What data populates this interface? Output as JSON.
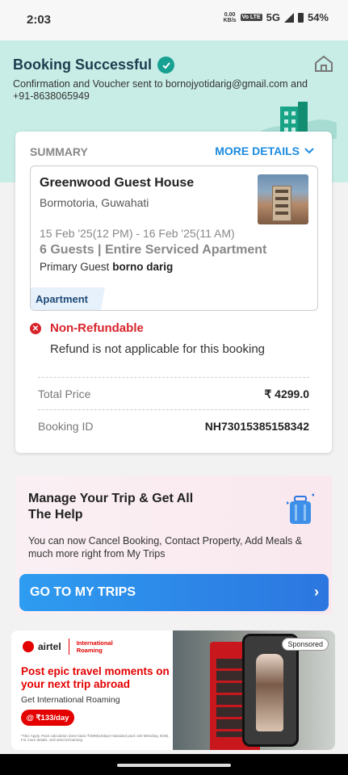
{
  "status_bar": {
    "time": "2:03",
    "speed_value": "0.00",
    "speed_unit": "KB/s",
    "lte": "Vo LTE",
    "network": "5G",
    "battery": "54%"
  },
  "header": {
    "title": "Booking Successful",
    "subtitle": "Confirmation and Voucher sent to bornojyotidarig@gmail.com and +91-8638065949"
  },
  "summary": {
    "label": "SUMMARY",
    "more_details": "MORE DETAILS",
    "hotel": {
      "name": "Greenwood Guest House",
      "location": "Bormotoria, Guwahati",
      "dates": "15 Feb '25(12 PM) - 16 Feb '25(11 AM)",
      "guests": "6 Guests | Entire Serviced Apartment",
      "primary_label": "Primary Guest",
      "primary_name": "borno darig",
      "tag": "Apartment"
    },
    "refund": {
      "title": "Non-Refundable",
      "text": "Refund is not applicable for this booking"
    },
    "total_price_label": "Total Price",
    "total_price_value": "₹ 4299.0",
    "booking_id_label": "Booking ID",
    "booking_id_value": "NH73015385158342"
  },
  "promo": {
    "title": "Manage Your Trip & Get All The Help",
    "text": "You can now Cancel Booking, Contact Property, Add Meals & much more right from My Trips",
    "button": "GO TO MY TRIPS"
  },
  "ad": {
    "brand": "airtel",
    "brand_sub_line1": "International",
    "brand_sub_line2": "Roaming",
    "headline": "Post epic travel moments on your next trip abroad",
    "subline": "Get International Roaming",
    "price": "@ ₹133/day",
    "fineprint": "*T&C Apply. Pack calculation done basis ₹3999(10days+standard pack 100 Mins/day, 5GB). For more details, visit airtel.in/roaming",
    "sponsored": "Sponsored"
  },
  "colors": {
    "header_bg": "#c8ede6",
    "accent_blue": "#1b8be0",
    "error_red": "#d8232a",
    "success_teal": "#18a192"
  }
}
